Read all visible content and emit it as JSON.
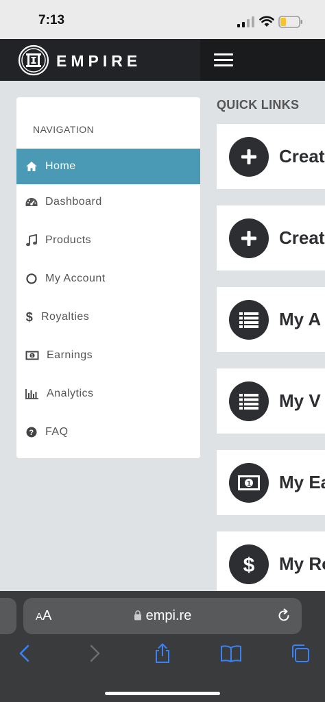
{
  "status_bar": {
    "time": "7:13"
  },
  "header": {
    "brand": "EMPIRE"
  },
  "navigation": {
    "title": "NAVIGATION",
    "items": [
      {
        "label": "Home",
        "icon": "home-icon",
        "active": true
      },
      {
        "label": "Dashboard",
        "icon": "dashboard-gauge-icon"
      },
      {
        "label": "Products",
        "icon": "music-note-icon"
      },
      {
        "label": "My Account",
        "icon": "circle-icon"
      },
      {
        "label": "Royalties",
        "icon": "dollar-icon"
      },
      {
        "label": "Earnings",
        "icon": "money-bill-icon"
      },
      {
        "label": "Analytics",
        "icon": "bar-chart-icon"
      },
      {
        "label": "FAQ",
        "icon": "question-circle-icon"
      }
    ]
  },
  "quick_links": {
    "title": "QUICK LINKS",
    "items": [
      {
        "label": "Creat",
        "icon": "plus-icon"
      },
      {
        "label": "Creat",
        "icon": "plus-icon"
      },
      {
        "label": "My A",
        "icon": "list-icon"
      },
      {
        "label": "My V",
        "icon": "list-icon"
      },
      {
        "label": "My Ea",
        "icon": "money-bill-icon"
      },
      {
        "label": "My Ro",
        "icon": "dollar-icon"
      }
    ]
  },
  "safari": {
    "text_size": "AA",
    "url": "empi.re"
  },
  "colors": {
    "active_nav": "#4a9ab5",
    "header_bg": "#1a1b1d",
    "page_bg": "#dfe2e5",
    "icon_circle": "#2c2e31",
    "safari_blue": "#3a82f7"
  }
}
